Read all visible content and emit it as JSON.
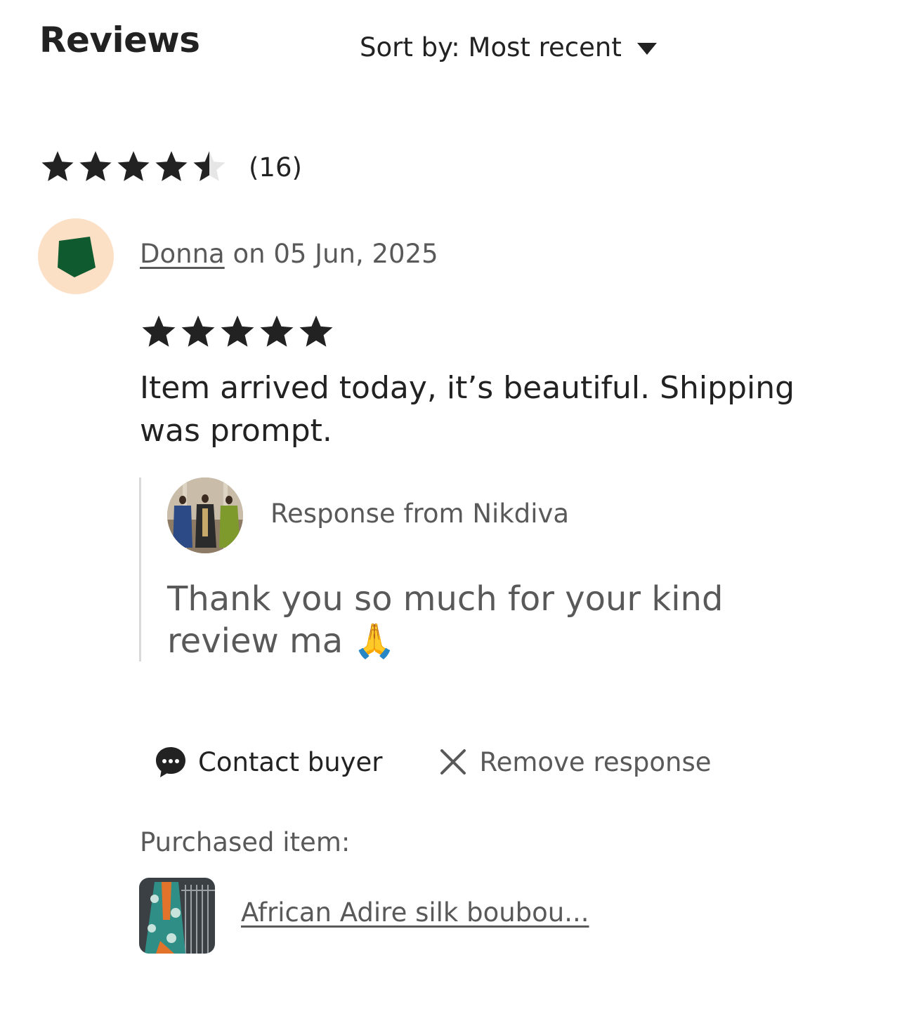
{
  "header": {
    "title": "Reviews",
    "sort_label": "Sort by: Most recent"
  },
  "summary": {
    "rating": 4.5,
    "max_rating": 5,
    "count_text": "(16)"
  },
  "review": {
    "reviewer_name": "Donna",
    "date_text": " on 05 Jun, 2025",
    "rating": 5,
    "text": "Item arrived today, it’s beautiful. Shipping was prompt.",
    "response": {
      "label": "Response from Nikdiva",
      "text": "Thank you so much for your kind review ma 🙏"
    },
    "actions": {
      "contact_label": "Contact buyer",
      "remove_label": "Remove response"
    },
    "purchased": {
      "label": "Purchased item:",
      "item_title": "African Adire silk boubou..."
    }
  },
  "colors": {
    "text_primary": "#222222",
    "text_secondary": "#595959",
    "buyer_avatar_bg": "#fce0c6",
    "buyer_avatar_shape": "#0f5a2e",
    "response_border": "#d9d9d9"
  }
}
